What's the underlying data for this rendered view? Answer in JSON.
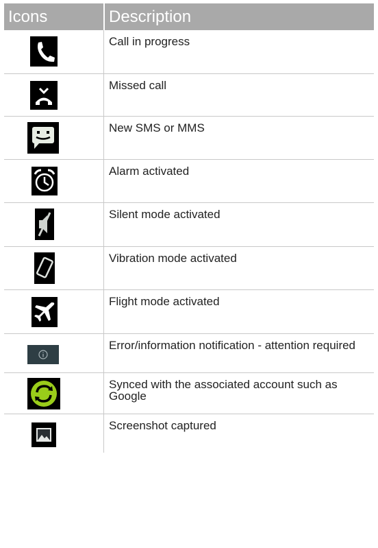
{
  "header": {
    "col_icons": "Icons",
    "col_description": "Description"
  },
  "rows": [
    {
      "icon": "phone-call-icon",
      "description": "Call in progress"
    },
    {
      "icon": "missed-call-icon",
      "description": "Missed call"
    },
    {
      "icon": "sms-message-icon",
      "description": "New SMS or MMS"
    },
    {
      "icon": "alarm-clock-icon",
      "description": "Alarm activated"
    },
    {
      "icon": "silent-mode-icon",
      "description": "Silent mode activated"
    },
    {
      "icon": "vibration-mode-icon",
      "description": "Vibration mode activated"
    },
    {
      "icon": "airplane-icon",
      "description": "Flight mode activated"
    },
    {
      "icon": "info-icon",
      "description": "Error/information notification -  attention required"
    },
    {
      "icon": "sync-icon",
      "description": "Synced with the associated account such as Google"
    },
    {
      "icon": "screenshot-icon",
      "description": "Screenshot captured"
    }
  ],
  "colors": {
    "header_bg": "#a9a9a9",
    "header_text": "#ffffff",
    "sync_green": "#9acd1a",
    "info_bg": "#2e3e44"
  }
}
